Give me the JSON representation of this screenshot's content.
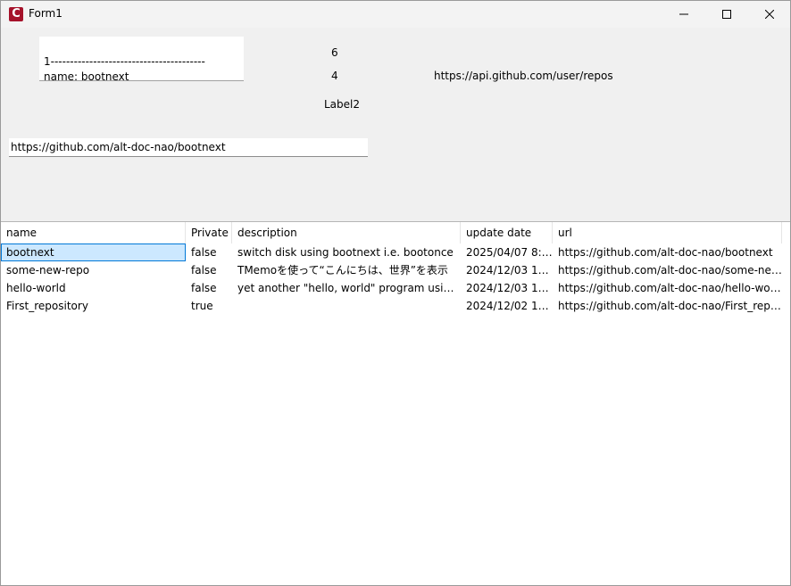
{
  "window": {
    "title": "Form1",
    "app_icon_letter": "C",
    "accent": "#a5122a"
  },
  "memo": {
    "lines": [
      "1----------------------------------------",
      "name: bootnext"
    ]
  },
  "labels": {
    "count_total": "6",
    "count_shown": "4",
    "api_url": "https://api.github.com/user/repos",
    "label2": "Label2"
  },
  "url_input": {
    "value": "https://github.com/alt-doc-nao/bootnext"
  },
  "listview": {
    "columns": [
      "name",
      "Private",
      "description",
      "update date",
      "url"
    ],
    "rows": [
      [
        "bootnext",
        "false",
        "switch disk using bootnext i.e. bootonce",
        "2025/04/07 8:5...",
        "https://github.com/alt-doc-nao/bootnext"
      ],
      [
        "some-new-repo",
        "false",
        "TMemoを使って“こんにちは、世界”を表示",
        "2024/12/03 16:...",
        "https://github.com/alt-doc-nao/some-new-..."
      ],
      [
        "hello-world",
        "false",
        "yet another \"hello, world\" program using t...",
        "2024/12/03 14:...",
        "https://github.com/alt-doc-nao/hello-world"
      ],
      [
        "First_repository",
        "true",
        "",
        "2024/12/02 16:...",
        "https://github.com/alt-doc-nao/First_reposi..."
      ]
    ],
    "selected_row": 0,
    "selection_color": "#cce8ff"
  },
  "icons": {
    "minimize": "minimize-icon",
    "maximize": "maximize-icon",
    "close": "close-icon"
  }
}
